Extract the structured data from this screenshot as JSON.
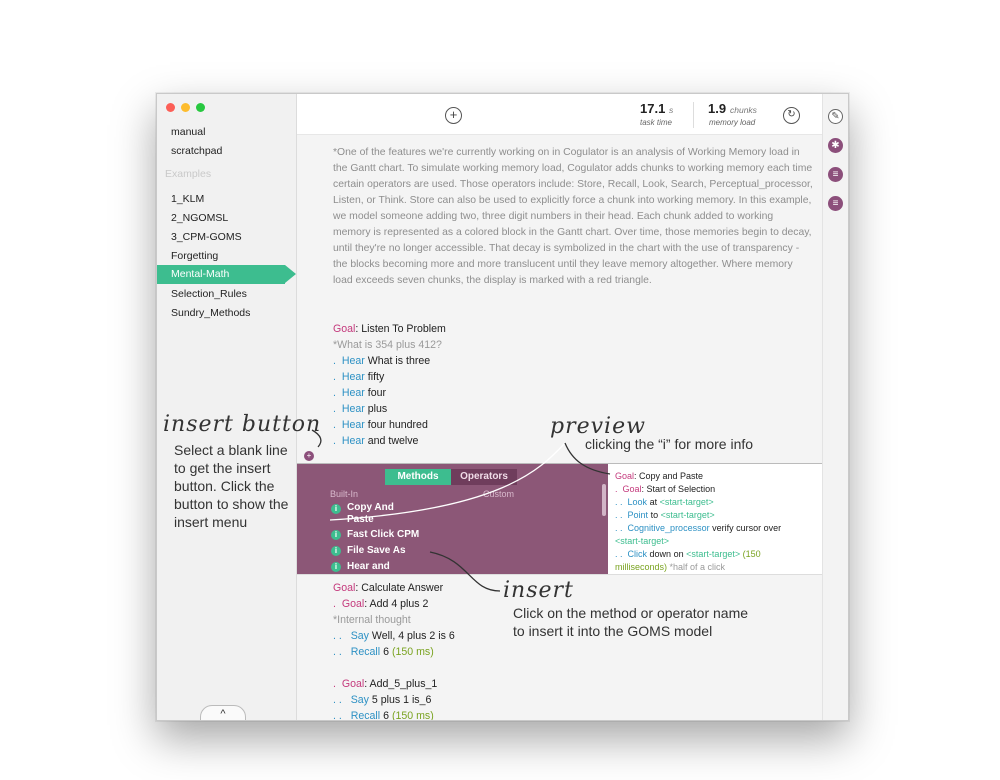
{
  "sidebar": {
    "items_top": [
      "manual",
      "scratchpad"
    ],
    "examples_header": "Examples",
    "examples": [
      "1_KLM",
      "2_NGOMSL",
      "3_CPM-GOMS",
      "Forgetting",
      "Mental-Math",
      "Selection_Rules",
      "Sundry_Methods"
    ],
    "active": "Mental-Math",
    "collapse_label": "^"
  },
  "toolbar": {
    "add_label": "+",
    "task_time_value": "17.1",
    "task_time_unit": "s",
    "task_time_caption": "task time",
    "memory_value": "1.9",
    "memory_unit": "chunks",
    "memory_caption": "memory load",
    "refresh_label": "↻"
  },
  "right_toolbar": {
    "icons": [
      "edit-icon",
      "asterisk-icon",
      "list-icon",
      "list-alt-icon"
    ]
  },
  "editor": {
    "description": "*One of the features we're currently working on in Cogulator is an analysis of Working Memory load in the Gantt chart.    To simulate working memory load, Cogulator adds chunks to working memory each time certain operators are used.    Those operators include: Store, Recall, Look, Search, Perceptual_processor, Listen, or Think.    Store can also be used to explicitly force a chunk into working memory.    In this example, we model someone adding two, three digit numbers in their head.    Each chunk added to working memory is represented as a colored block in the Gantt chart.    Over time, those memories begin to decay, until they're no longer accessible.    That decay is symbolized in the chart with the use of transparency - the blocks becoming more and more translucent until they leave memory altogether.    Where memory load exceeds seven chunks, the display is marked with a red triangle.",
    "goal1_kw": "Goal",
    "goal1_text": ": Listen To Problem",
    "goal1_comment": "*What is 354 plus 412?",
    "hear_lines": [
      {
        "dots": ".",
        "op": "Hear",
        "text": "What is three"
      },
      {
        "dots": ".",
        "op": "Hear",
        "text": "fifty"
      },
      {
        "dots": ".",
        "op": "Hear",
        "text": "four"
      },
      {
        "dots": ".",
        "op": "Hear",
        "text": "plus"
      },
      {
        "dots": ".",
        "op": "Hear",
        "text": "four hundred"
      },
      {
        "dots": ".",
        "op": "Hear",
        "text": "and twelve"
      }
    ],
    "insert_dot": "+",
    "goal2_kw": "Goal",
    "goal2_text": ": Calculate Answer",
    "goal2_sub_dots": ".",
    "goal2_sub_kw": "Goal",
    "goal2_sub_text": ": Add 4 plus 2",
    "goal2_comment": "*Internal thought",
    "say1_dots": ". .",
    "say1_op": "Say",
    "say1_text": "Well, 4 plus 2 is 6",
    "recall1_dots": ". .",
    "recall1_op": "Recall",
    "recall1_text": "6",
    "recall1_dur": "(150 ms)",
    "goal3_dots": ".",
    "goal3_kw": "Goal",
    "goal3_text": ": Add_5_plus_1",
    "say2_dots": ". .",
    "say2_op": "Say",
    "say2_text": "5 plus 1 is_6",
    "recall2_dots": ". .",
    "recall2_op": "Recall",
    "recall2_text": "6",
    "recall2_dur": "(150 ms)"
  },
  "insert_menu": {
    "tab_methods": "Methods",
    "tab_operators": "Operators",
    "sub_builtin": "Built-In",
    "sub_custom": "Custom",
    "items": [
      "Copy And Paste",
      "Fast Click CPM",
      "File Save As",
      "Hear and"
    ],
    "info_glyph": "i",
    "preview": {
      "goal_kw": "Goal",
      "goal_text": ": Copy and Paste",
      "l2_dots": ".",
      "l2_kw": "Goal",
      "l2_text": ": Start of Selection",
      "l3_dots": ". .",
      "l3_op": "Look",
      "l3_text": "at",
      "l3_tgt": "<start-target>",
      "l4_dots": ". .",
      "l4_op": "Point",
      "l4_text": "to",
      "l4_tgt": "<start-target>",
      "l5_dots": ". .",
      "l5_op": "Cognitive_processor",
      "l5_text": "verify cursor over",
      "l5b_tgt": "<start-target>",
      "l6_dots": ". .",
      "l6_op": "Click",
      "l6_text": "down on",
      "l6_tgt": "<start-target>",
      "l6_dur": "(150",
      "l7_dur": "milliseconds)",
      "l7_cmt": "*half of a click"
    }
  },
  "annotations": {
    "insert_button_title": "insert button",
    "insert_button_body": "Select a blank line to get the insert button. Click the button to show the insert menu",
    "preview_title": "preview",
    "preview_body": "clicking the “i” for more info",
    "insert_title": "insert",
    "insert_body": "Click on the method or operator name to insert it into the GOMS model"
  },
  "colors": {
    "accent_green": "#3dbd8f",
    "menu_purple": "#8c5777",
    "goal_pink": "#c4397c",
    "operator_blue": "#2d91c4",
    "duration_green": "#7aa320"
  }
}
